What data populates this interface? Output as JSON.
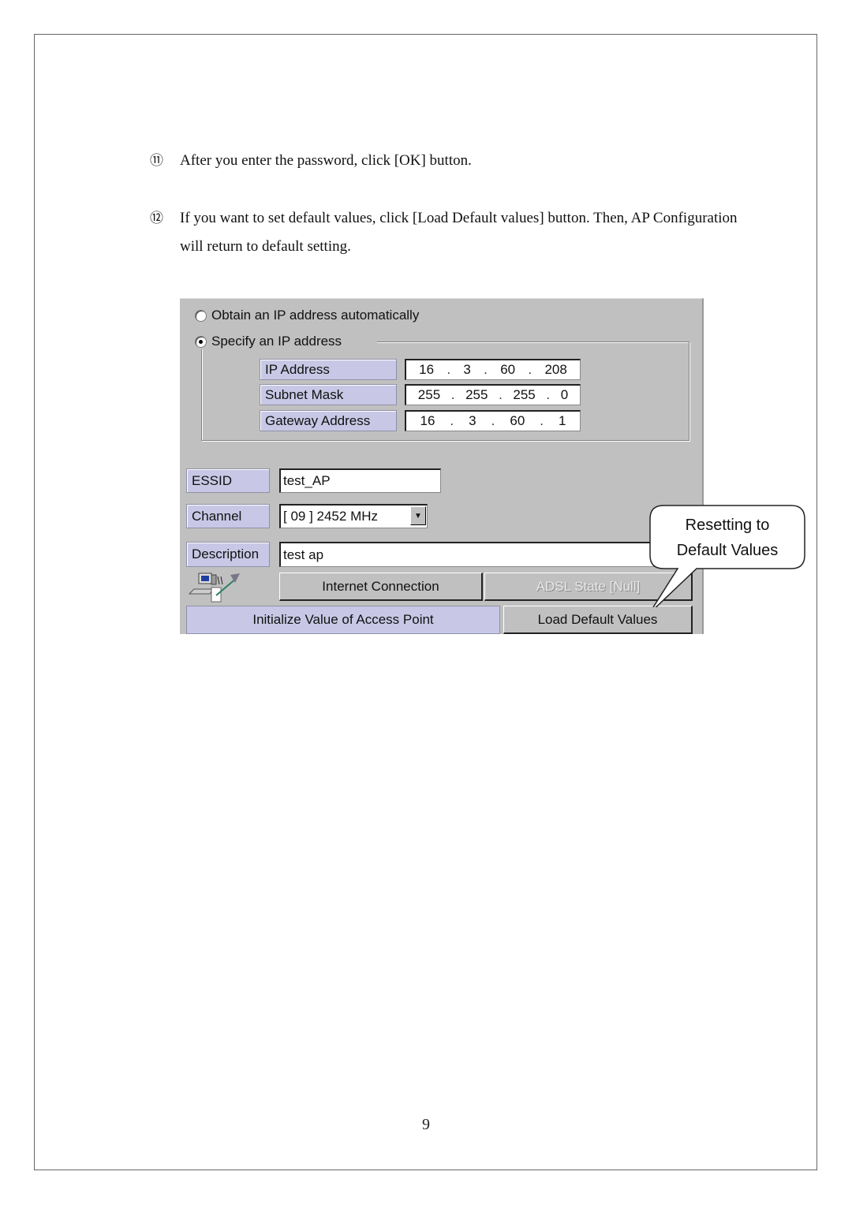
{
  "document": {
    "steps": [
      {
        "number": "⑪",
        "text": "After you enter the password, click [OK] button."
      },
      {
        "number": "⑫",
        "text": "If you want to set default values, click [Load Default values] button. Then, AP Configuration will return to default setting."
      }
    ],
    "page_number": "9"
  },
  "screenshot": {
    "ip_mode": {
      "options": [
        {
          "label": "Obtain an IP address automatically",
          "checked": false
        },
        {
          "label": "Specify an IP address",
          "checked": true
        }
      ]
    },
    "ip_settings": [
      {
        "label": "IP Address",
        "octets": [
          "16",
          "3",
          "60",
          "208"
        ]
      },
      {
        "label": "Subnet Mask",
        "octets": [
          "255",
          "255",
          "255",
          "0"
        ]
      },
      {
        "label": "Gateway Address",
        "octets": [
          "16",
          "3",
          "60",
          "1"
        ]
      }
    ],
    "essid": {
      "label": "ESSID",
      "value": "test_AP"
    },
    "channel": {
      "label": "Channel",
      "value": "[ 09 ] 2452 MHz"
    },
    "description": {
      "label": "Description",
      "value": "test ap"
    },
    "buttons": {
      "internet_connection": "Internet Connection",
      "adsl_state": "ADSL State [Null]",
      "load_defaults": "Load Default Values"
    },
    "init_label": "Initialize Value of Access Point",
    "icons": {
      "network": "network-connection-icon",
      "dropdown": "chevron-down-icon"
    }
  },
  "callout": {
    "line1": "Resetting to",
    "line2": "Default Values"
  }
}
